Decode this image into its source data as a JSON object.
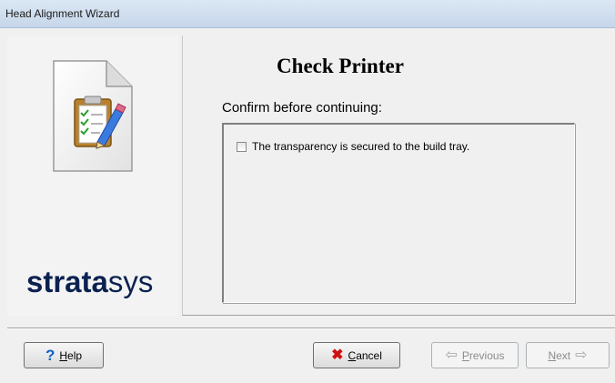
{
  "window": {
    "title": "Head Alignment Wizard"
  },
  "sidebar": {
    "brand_bold": "strata",
    "brand_regular": "sys",
    "icon": "checklist-document-icon"
  },
  "page": {
    "heading": "Check Printer",
    "instruction": "Confirm before continuing:"
  },
  "checklist": {
    "items": [
      {
        "label": "The transparency is secured to the build tray.",
        "checked": false
      }
    ]
  },
  "buttons": {
    "help": {
      "mnemonic": "H",
      "rest": "elp",
      "icon": "question-mark-icon",
      "enabled": true
    },
    "cancel": {
      "mnemonic": "C",
      "rest": "ancel",
      "icon": "x-icon",
      "enabled": true
    },
    "previous": {
      "mnemonic": "P",
      "rest": "revious",
      "icon": "left-arrow-icon",
      "enabled": false
    },
    "next": {
      "mnemonic": "N",
      "rest": "ext",
      "icon": "right-arrow-icon",
      "enabled": false
    }
  },
  "colors": {
    "brand": "#0b2150",
    "cancel_icon": "#d01010",
    "help_icon": "#1060c8"
  }
}
